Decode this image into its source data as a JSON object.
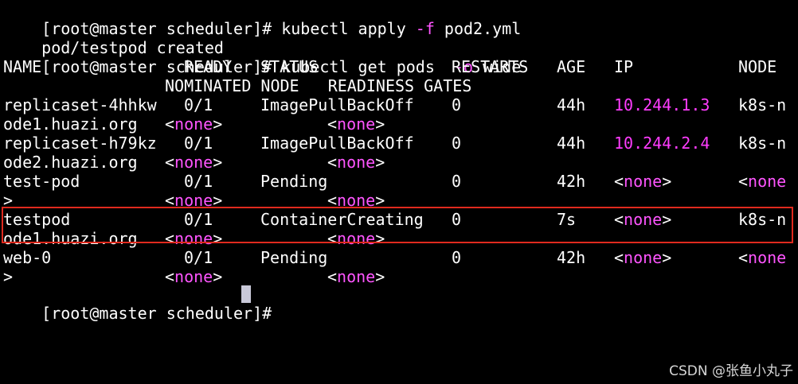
{
  "terminal": {
    "lines": [
      {
        "type": "cmd",
        "prompt": "[root@master scheduler]# ",
        "parts": [
          "kubectl apply ",
          "-f",
          " pod2.yml"
        ]
      },
      {
        "type": "text",
        "text": "pod/testpod created"
      },
      {
        "type": "cmd",
        "prompt": "[root@master scheduler]# ",
        "parts": [
          "kubectl get pods  ",
          "-o",
          " wide"
        ]
      }
    ],
    "header": {
      "row1": [
        "NAME",
        "READY",
        "STATUS",
        "RESTARTS",
        "AGE",
        "IP",
        "NODE"
      ],
      "row2": "NOMINATED NODE   READINESS GATES"
    },
    "pods": [
      {
        "name": "replicaset-4hhkw",
        "ready": "0/1",
        "status": "ImagePullBackOff",
        "restarts": "0",
        "age": "44h",
        "ip": "10.244.1.3",
        "ip_highlight": true,
        "node_part1": "k8s-n",
        "node_part2": "ode1.huazi.org",
        "nominated": "none",
        "readiness": "none"
      },
      {
        "name": "replicaset-h79kz",
        "ready": "0/1",
        "status": "ImagePullBackOff",
        "restarts": "0",
        "age": "44h",
        "ip": "10.244.2.4",
        "ip_highlight": true,
        "node_part1": "k8s-n",
        "node_part2": "ode2.huazi.org",
        "nominated": "none",
        "readiness": "none"
      },
      {
        "name": "test-pod",
        "ready": "0/1",
        "status": "Pending",
        "restarts": "0",
        "age": "42h",
        "ip": "none",
        "ip_highlight": false,
        "node_part1": "none",
        "node_part2": ">",
        "nominated": "none",
        "readiness": "none"
      },
      {
        "name": "testpod",
        "ready": "0/1",
        "status": "ContainerCreating",
        "restarts": "0",
        "age": "7s",
        "ip": "none",
        "ip_highlight": false,
        "node_part1": "k8s-n",
        "node_part2": "ode1.huazi.org",
        "nominated": "none",
        "readiness": "none"
      },
      {
        "name": "web-0",
        "ready": "0/1",
        "status": "Pending",
        "restarts": "0",
        "age": "42h",
        "ip": "none",
        "ip_highlight": false,
        "node_part1": "none",
        "node_part2": ">",
        "nominated": "none",
        "readiness": "none"
      }
    ],
    "final_prompt": "[root@master scheduler]# "
  },
  "watermark": "CSDN @张鱼小丸子",
  "colors": {
    "background": "#000000",
    "text": "#ffffff",
    "magenta": "#ff55ff",
    "highlight_border": "#e02a1e",
    "cursor": "#c8c8d8"
  }
}
